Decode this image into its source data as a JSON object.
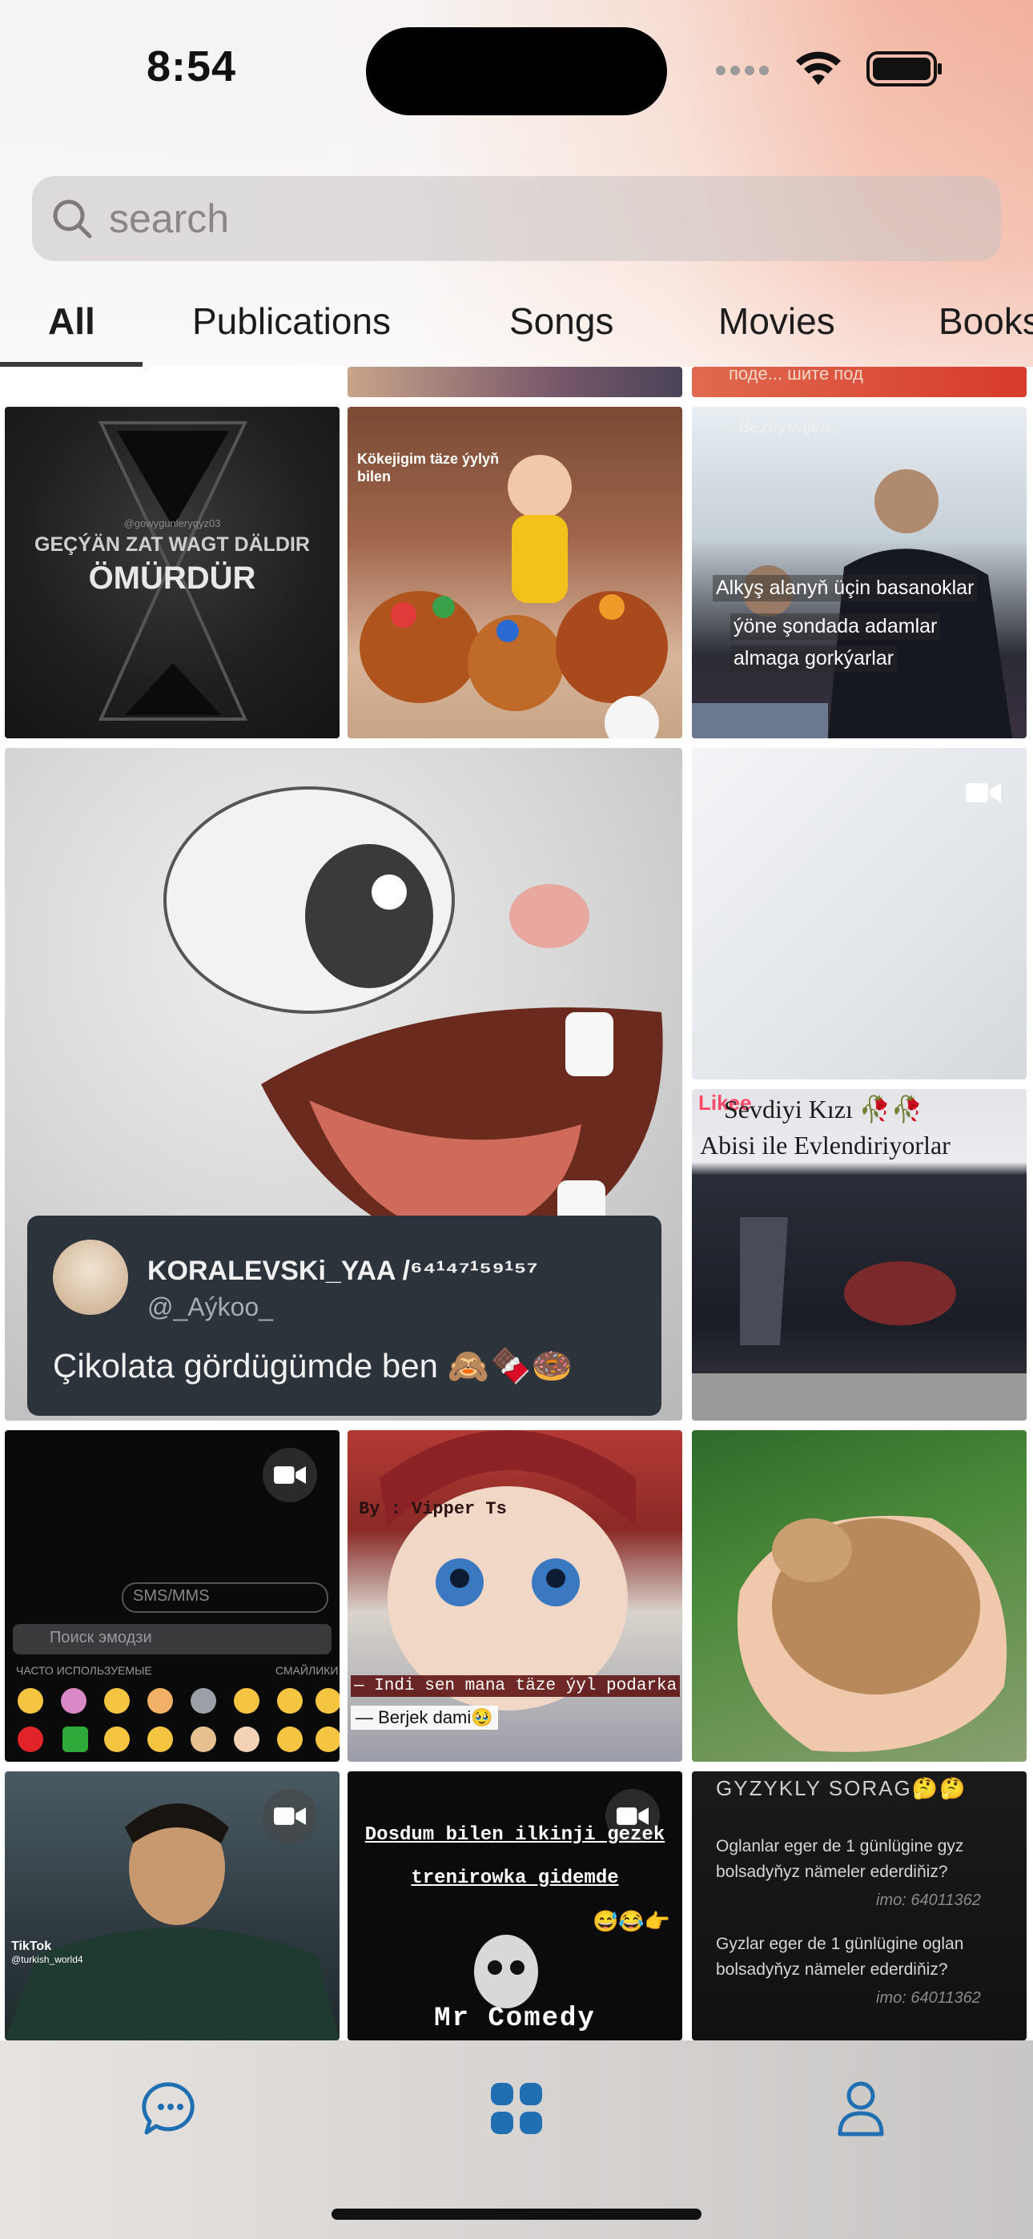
{
  "status": {
    "time": "8:54"
  },
  "search": {
    "placeholder": "search"
  },
  "tabs": [
    {
      "label": "All",
      "active": true
    },
    {
      "label": "Publications"
    },
    {
      "label": "Songs"
    },
    {
      "label": "Movies"
    },
    {
      "label": "Books"
    }
  ],
  "posts": {
    "top_partial": {
      "text": "поде... шите под"
    },
    "hourglass": {
      "watermark": "@gowygunleryqyz03",
      "line1": "GEÇÝÄN ZAT WAGT DÄLDIR",
      "line2": "ÖMÜRDÜR"
    },
    "baskets": {
      "caption": "Kökejigim täze ýylyň bilen"
    },
    "men_photo": {
      "header": "..Beziryenjen..",
      "line1": "Alkyş alanyň üçin basanoklar",
      "line2": "ýöne şondada adamlar",
      "line3": "almaga gorkýarlar"
    },
    "rabbit_meme": {
      "username": "KORALEVSKi_YAA /⁶⁴¹⁴⁷¹⁵⁹¹⁵⁷",
      "handle": "@_Aýkoo_",
      "text": "Çikolata gördügümde ben 🙈🍫🍩"
    },
    "likee": {
      "brand": "Likee",
      "line1": "Sevdiyi Kızı 🥀🥀",
      "line2": "Abisi ile Evlendiriyorlar"
    },
    "keyboard": {
      "field": "SMS/MMS",
      "search": "Поиск эмодзи",
      "frequent": "ЧАСТО ИСПОЛЬЗУЕМЫЕ",
      "smileys": "СМАЙЛИКИ"
    },
    "masha": {
      "top": "By : Vipper Ts",
      "line1": "— Indi sen mana täze ýyl podarka",
      "line2": "— Berjek dami🥹"
    },
    "tiktok": {
      "brand": "TikTok",
      "handle": "@turkish_world4"
    },
    "comedy": {
      "line1": "Dosdum bilen ilkinji gezek",
      "line2": "trenirowka gidemde",
      "emoji": "😅😂👉",
      "brand": "Mr Comedy"
    },
    "quiz": {
      "title": "GYZYKLY SORAG🤔🤔",
      "q1": "Oglanlar eger de 1 günlügine gyz bolsadyňyz nämeler ederdiňiz?",
      "imo1": "imo: 64011362",
      "q2": "Gyzlar eger de 1 günlügine oglan bolsadyňyz nämeler ederdiňiz?",
      "imo2": "imo: 64011362"
    }
  },
  "colors": {
    "accent": "#1f6fb2",
    "tab_underline": "#3b3b3b"
  },
  "bottom_nav": [
    {
      "icon": "chat-bubble-icon"
    },
    {
      "icon": "grid-apps-icon"
    },
    {
      "icon": "person-icon"
    }
  ]
}
